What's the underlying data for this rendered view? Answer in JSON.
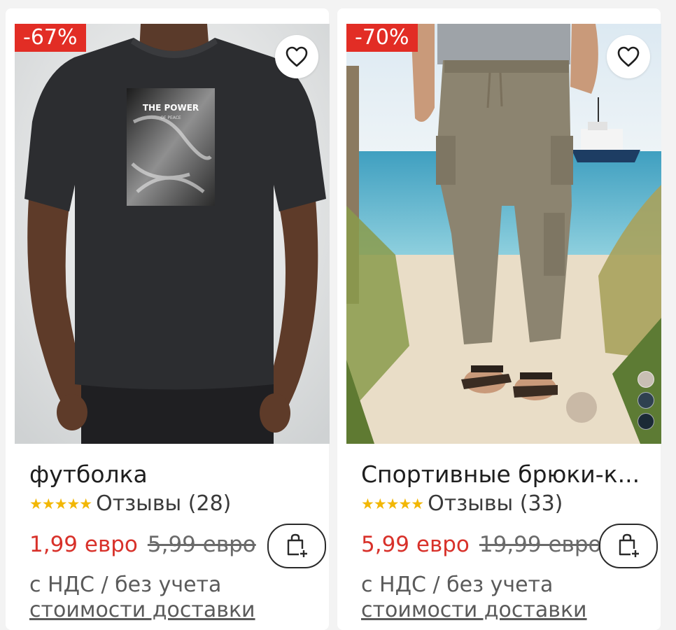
{
  "products": [
    {
      "discount": "-67%",
      "title": "футболка",
      "stars": "★★★★★",
      "reviews": "Отзывы (28)",
      "price_now": "1,99 евро",
      "price_old": "5,99 евро",
      "vat_text": "с НДС / без учета",
      "shipping_link": "стоимости доставки",
      "print_text": "THE POWER",
      "print_subtext": "OF PEACE"
    },
    {
      "discount": "-70%",
      "title": "Спортивные брюки-к...",
      "stars": "★★★★★",
      "reviews": "Отзывы (33)",
      "price_now": "5,99 евро",
      "price_old": "19,99 евро",
      "vat_text": "с НДС / без учета",
      "shipping_link": "стоимости доставки",
      "swatches": [
        "#c8bfb4",
        "#2f4150",
        "#1b2a36"
      ]
    }
  ],
  "colors": {
    "discount_bg": "#e22d25",
    "price_now": "#d8312a",
    "star": "#f2b705"
  },
  "icons": {
    "favorite": "heart-icon",
    "add_to_cart": "shopping-bag-plus-icon"
  }
}
